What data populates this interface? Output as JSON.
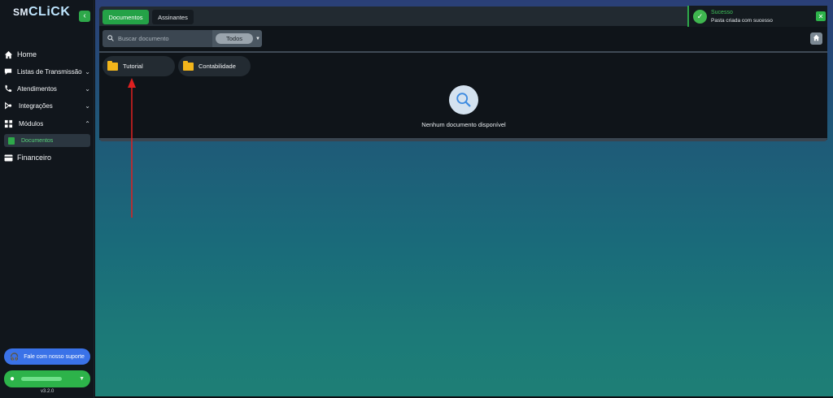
{
  "brand": {
    "logo_part1": "SM",
    "logo_part2": "CLiCK"
  },
  "sidebar": {
    "items": [
      {
        "label": "Home",
        "icon": "home-icon"
      },
      {
        "label": "Listas de Transmissão",
        "icon": "chat-icon"
      },
      {
        "label": "Atendimentos",
        "icon": "phone-icon"
      },
      {
        "label": "Integrações",
        "icon": "integrations-icon"
      },
      {
        "label": "Módulos",
        "icon": "grid-icon"
      },
      {
        "label": "Documentos",
        "icon": "document-icon"
      },
      {
        "label": "Financeiro",
        "icon": "card-icon"
      }
    ],
    "support_label": "Fale com nosso suporte",
    "version": "v3.2.0"
  },
  "tabs": [
    {
      "label": "Documentos",
      "active": true
    },
    {
      "label": "Assinantes",
      "active": false
    }
  ],
  "search": {
    "placeholder": "Buscar documento"
  },
  "filter": {
    "selected": "Todos"
  },
  "folders": [
    {
      "name": "Tutorial"
    },
    {
      "name": "Contabilidade"
    }
  ],
  "empty_state": {
    "message": "Nenhum documento disponível"
  },
  "toast": {
    "title": "Sucesso",
    "message": "Pasta criada com sucesso"
  },
  "colors": {
    "accent_green": "#2ea84a",
    "support_blue": "#3a72e8",
    "folder_yellow": "#f2b51b",
    "annotation_red": "#e02020"
  }
}
